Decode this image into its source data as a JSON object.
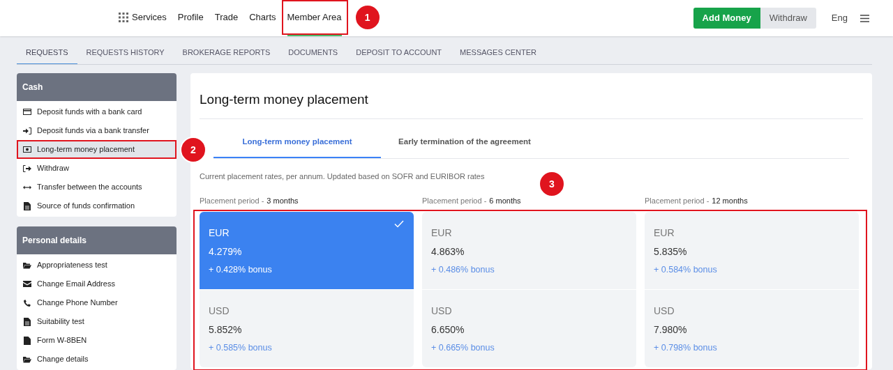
{
  "header": {
    "nav": [
      {
        "label": "Services",
        "kind": "menu",
        "selected": false
      },
      {
        "label": "Profile",
        "kind": "link",
        "selected": false
      },
      {
        "label": "Trade",
        "kind": "link",
        "selected": false
      },
      {
        "label": "Charts",
        "kind": "link",
        "selected": false
      },
      {
        "label": "Member Area",
        "kind": "link",
        "selected": true,
        "callout": "1"
      }
    ],
    "add_money": "Add Money",
    "withdraw": "Withdraw",
    "language": "Eng"
  },
  "subnav": [
    {
      "label": "REQUESTS",
      "selected": true
    },
    {
      "label": "REQUESTS HISTORY",
      "selected": false
    },
    {
      "label": "BROKERAGE REPORTS",
      "selected": false
    },
    {
      "label": "DOCUMENTS",
      "selected": false
    },
    {
      "label": "DEPOSIT TO ACCOUNT",
      "selected": false
    },
    {
      "label": "MESSAGES CENTER",
      "selected": false
    }
  ],
  "sidebar": [
    {
      "title": "Cash",
      "items": [
        {
          "label": "Deposit funds with a bank card",
          "selected": false
        },
        {
          "label": "Deposit funds via a bank transfer",
          "selected": false
        },
        {
          "label": "Long-term money placement",
          "selected": true,
          "callout": "2"
        },
        {
          "label": "Withdraw",
          "selected": false
        },
        {
          "label": "Transfer between the accounts",
          "selected": false
        },
        {
          "label": "Source of funds confirmation",
          "selected": false
        }
      ]
    },
    {
      "title": "Personal details",
      "items": [
        {
          "label": "Appropriateness test",
          "selected": false
        },
        {
          "label": "Change Email Address",
          "selected": false
        },
        {
          "label": "Change Phone Number",
          "selected": false
        },
        {
          "label": "Suitability test",
          "selected": false
        },
        {
          "label": "Form W-8BEN",
          "selected": false
        },
        {
          "label": "Change details",
          "selected": false
        }
      ]
    }
  ],
  "main": {
    "title": "Long-term money placement",
    "tabs": [
      {
        "label": "Long-term money placement",
        "selected": true
      },
      {
        "label": "Early termination of the agreement",
        "selected": false
      }
    ],
    "description": "Current placement rates, per annum. Updated based on SOFR and EURIBOR rates",
    "callout": "3",
    "periods": [
      {
        "label": "Placement period -",
        "value": "3 months",
        "options": [
          {
            "currency": "EUR",
            "rate": "4.279%",
            "bonus": "+ 0.428% bonus",
            "selected": true
          },
          {
            "currency": "USD",
            "rate": "5.852%",
            "bonus": "+ 0.585% bonus",
            "selected": false
          }
        ]
      },
      {
        "label": "Placement period -",
        "value": "6 months",
        "options": [
          {
            "currency": "EUR",
            "rate": "4.863%",
            "bonus": "+ 0.486% bonus",
            "selected": false
          },
          {
            "currency": "USD",
            "rate": "6.650%",
            "bonus": "+ 0.665% bonus",
            "selected": false
          }
        ]
      },
      {
        "label": "Placement period -",
        "value": "12 months",
        "options": [
          {
            "currency": "EUR",
            "rate": "5.835%",
            "bonus": "+ 0.584% bonus",
            "selected": false
          },
          {
            "currency": "USD",
            "rate": "7.980%",
            "bonus": "+ 0.798% bonus",
            "selected": false
          }
        ]
      }
    ]
  }
}
